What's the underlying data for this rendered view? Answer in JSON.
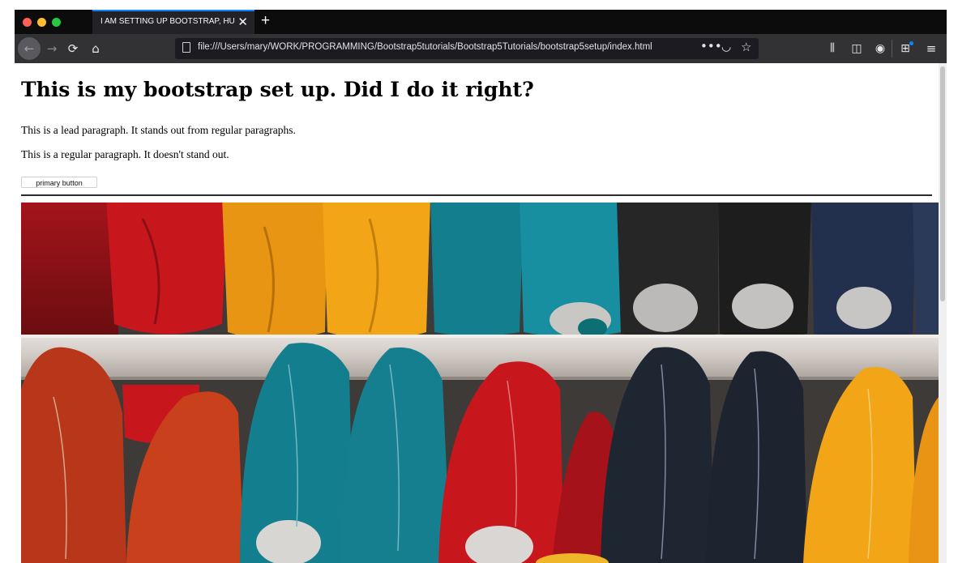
{
  "browser": {
    "tab_title": "I AM SETTING UP BOOTSTRAP, HUGE",
    "tab_close": "✕",
    "new_tab": "+",
    "url": "file:///Users/mary/WORK/PROGRAMMING/Bootstrap5tutorials/Bootstrap5Tutorials/bootstrap5setup/index.html",
    "url_more": "•••",
    "icons": {
      "back": "back-arrow-icon",
      "forward": "forward-arrow-icon",
      "reload": "reload-icon",
      "home": "home-icon",
      "page": "document-icon",
      "page_actions": "ellipsis-icon",
      "pocket": "pocket-icon",
      "bookmark": "star-icon",
      "library": "library-icon",
      "sidebar": "sidebar-icon",
      "account": "account-icon",
      "extensions": "extensions-icon",
      "menu": "hamburger-menu-icon"
    }
  },
  "page": {
    "heading": "This is my bootstrap set up. Did I do it right?",
    "lead": "This is a lead paragraph. It stands out from regular paragraphs.",
    "regular": "This is a regular paragraph. It doesn't stand out.",
    "button_label": "primary button"
  },
  "colors": {
    "accent": "#0a84ff",
    "toolbar": "#323234",
    "tabstrip": "#0c0c0d"
  }
}
